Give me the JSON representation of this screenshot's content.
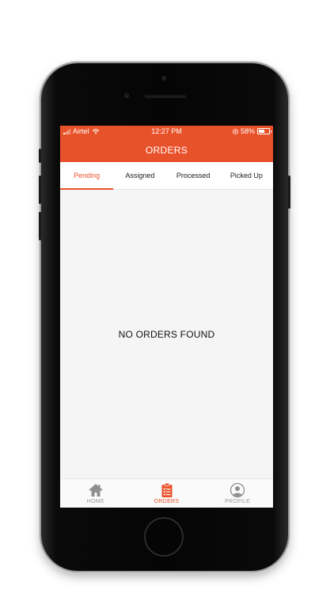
{
  "status_bar": {
    "carrier": "Airtel",
    "time": "12:27 PM",
    "battery_percent": "58%"
  },
  "nav": {
    "title": "ORDERS"
  },
  "tabs": [
    {
      "label": "Pending",
      "active": true
    },
    {
      "label": "Assigned",
      "active": false
    },
    {
      "label": "Processed",
      "active": false
    },
    {
      "label": "Picked Up",
      "active": false
    }
  ],
  "content": {
    "empty_message": "NO ORDERS FOUND"
  },
  "tab_bar": [
    {
      "label": "HOME",
      "icon": "home-icon",
      "active": false
    },
    {
      "label": "ORDERS",
      "icon": "clipboard-icon",
      "active": true
    },
    {
      "label": "PROFILE",
      "icon": "profile-icon",
      "active": false
    }
  ],
  "colors": {
    "accent": "#e8522a",
    "inactive": "#9a9a9a",
    "background": "#f5f5f5"
  }
}
